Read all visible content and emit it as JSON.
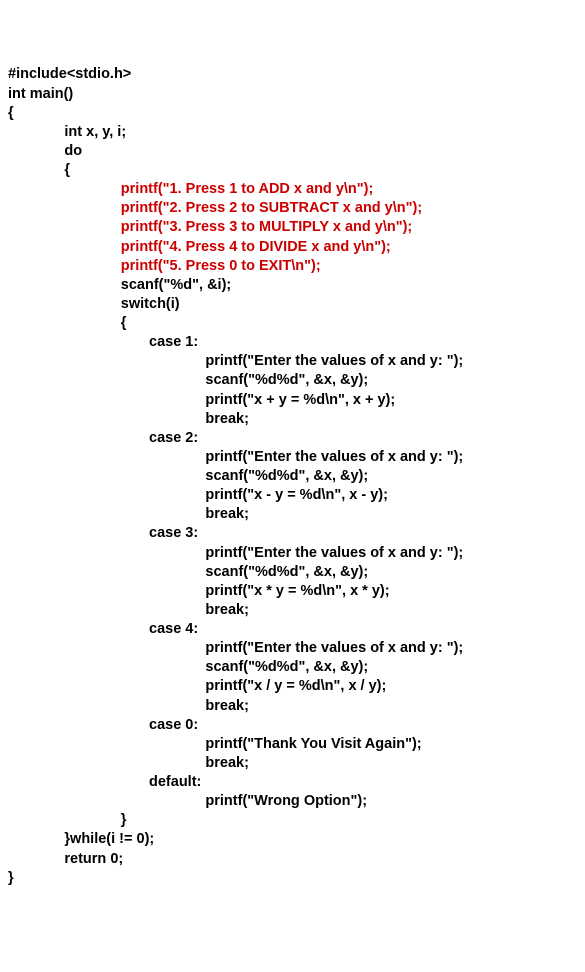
{
  "lines": [
    {
      "t": "#include<stdio.h>",
      "i": 0,
      "c": "black"
    },
    {
      "t": "int main()",
      "i": 0,
      "c": "black"
    },
    {
      "t": "{",
      "i": 0,
      "c": "black"
    },
    {
      "t": "int x, y, i;",
      "i": 2,
      "c": "black"
    },
    {
      "t": "do",
      "i": 2,
      "c": "black"
    },
    {
      "t": "{",
      "i": 2,
      "c": "black"
    },
    {
      "t": "printf(\"1. Press 1 to ADD x and y\\n\");",
      "i": 4,
      "c": "red"
    },
    {
      "t": "printf(\"2. Press 2 to SUBTRACT x and y\\n\");",
      "i": 4,
      "c": "red"
    },
    {
      "t": "printf(\"3. Press 3 to MULTIPLY x and y\\n\");",
      "i": 4,
      "c": "red"
    },
    {
      "t": "printf(\"4. Press 4 to DIVIDE x and y\\n\");",
      "i": 4,
      "c": "red"
    },
    {
      "t": "printf(\"5. Press 0 to EXIT\\n\");",
      "i": 4,
      "c": "red"
    },
    {
      "t": "scanf(\"%d\", &i);",
      "i": 4,
      "c": "black"
    },
    {
      "t": "switch(i)",
      "i": 4,
      "c": "black"
    },
    {
      "t": "{",
      "i": 4,
      "c": "black"
    },
    {
      "t": "case 1:",
      "i": 5,
      "c": "black"
    },
    {
      "t": "printf(\"Enter the values of x and y: \");",
      "i": 7,
      "c": "black"
    },
    {
      "t": "scanf(\"%d%d\", &x, &y);",
      "i": 7,
      "c": "black"
    },
    {
      "t": "printf(\"x + y = %d\\n\", x + y);",
      "i": 7,
      "c": "black"
    },
    {
      "t": "break;",
      "i": 7,
      "c": "black"
    },
    {
      "t": "case 2:",
      "i": 5,
      "c": "black"
    },
    {
      "t": "printf(\"Enter the values of x and y: \");",
      "i": 7,
      "c": "black"
    },
    {
      "t": "scanf(\"%d%d\", &x, &y);",
      "i": 7,
      "c": "black"
    },
    {
      "t": "printf(\"x - y = %d\\n\", x - y);",
      "i": 7,
      "c": "black"
    },
    {
      "t": "break;",
      "i": 7,
      "c": "black"
    },
    {
      "t": "case 3:",
      "i": 5,
      "c": "black"
    },
    {
      "t": "printf(\"Enter the values of x and y: \");",
      "i": 7,
      "c": "black"
    },
    {
      "t": "scanf(\"%d%d\", &x, &y);",
      "i": 7,
      "c": "black"
    },
    {
      "t": "printf(\"x * y = %d\\n\", x * y);",
      "i": 7,
      "c": "black"
    },
    {
      "t": "break;",
      "i": 7,
      "c": "black"
    },
    {
      "t": "case 4:",
      "i": 5,
      "c": "black"
    },
    {
      "t": "printf(\"Enter the values of x and y: \");",
      "i": 7,
      "c": "black"
    },
    {
      "t": "scanf(\"%d%d\", &x, &y);",
      "i": 7,
      "c": "black"
    },
    {
      "t": "printf(\"x / y = %d\\n\", x / y);",
      "i": 7,
      "c": "black"
    },
    {
      "t": "break;",
      "i": 7,
      "c": "black"
    },
    {
      "t": "case 0:",
      "i": 5,
      "c": "black"
    },
    {
      "t": "printf(\"Thank You Visit Again\");",
      "i": 7,
      "c": "black"
    },
    {
      "t": "break;",
      "i": 7,
      "c": "black"
    },
    {
      "t": "default:",
      "i": 5,
      "c": "black"
    },
    {
      "t": "printf(\"Wrong Option\");",
      "i": 7,
      "c": "black"
    },
    {
      "t": "}",
      "i": 4,
      "c": "black"
    },
    {
      "t": "}while(i != 0);",
      "i": 2,
      "c": "black"
    },
    {
      "t": "return 0;",
      "i": 2,
      "c": "black"
    },
    {
      "t": "}",
      "i": 0,
      "c": "black"
    }
  ],
  "indent_unit": "       "
}
